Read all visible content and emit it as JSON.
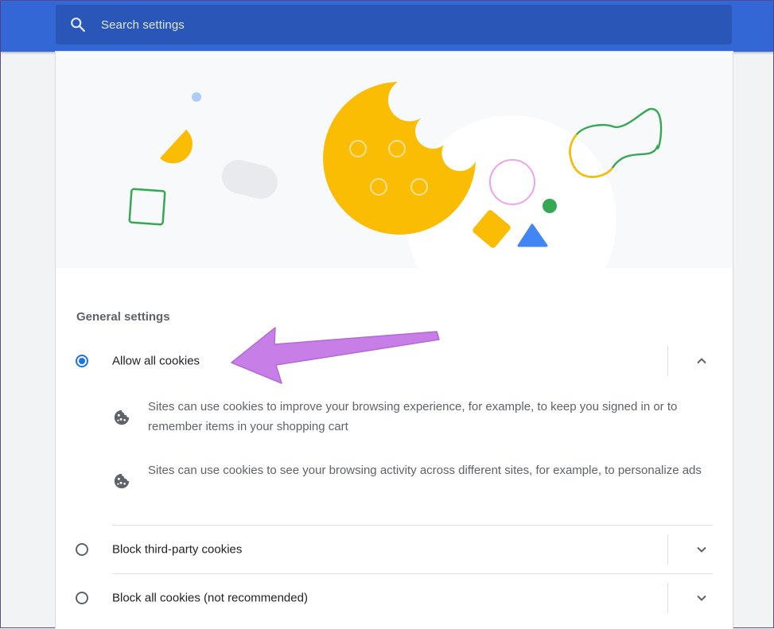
{
  "search": {
    "placeholder": "Search settings"
  },
  "section": {
    "title": "General settings"
  },
  "options": [
    {
      "label": "Allow all cookies",
      "selected": true,
      "expanded": true
    },
    {
      "label": "Block third-party cookies",
      "selected": false,
      "expanded": false
    },
    {
      "label": "Block all cookies (not recommended)",
      "selected": false,
      "expanded": false
    }
  ],
  "allow_details": [
    {
      "icon": "cookie-icon",
      "text": "Sites can use cookies to improve your browsing experience, for example, to keep you signed in or to remember items in your shopping cart"
    },
    {
      "icon": "cookie-icon",
      "text": "Sites can use cookies to see your browsing activity across different sites, for example, to personalize ads"
    }
  ],
  "colors": {
    "header": "#3367d6",
    "accent": "#1a73e8",
    "cookie": "#fbbc04",
    "annotation_arrow": "#c77ee6"
  }
}
